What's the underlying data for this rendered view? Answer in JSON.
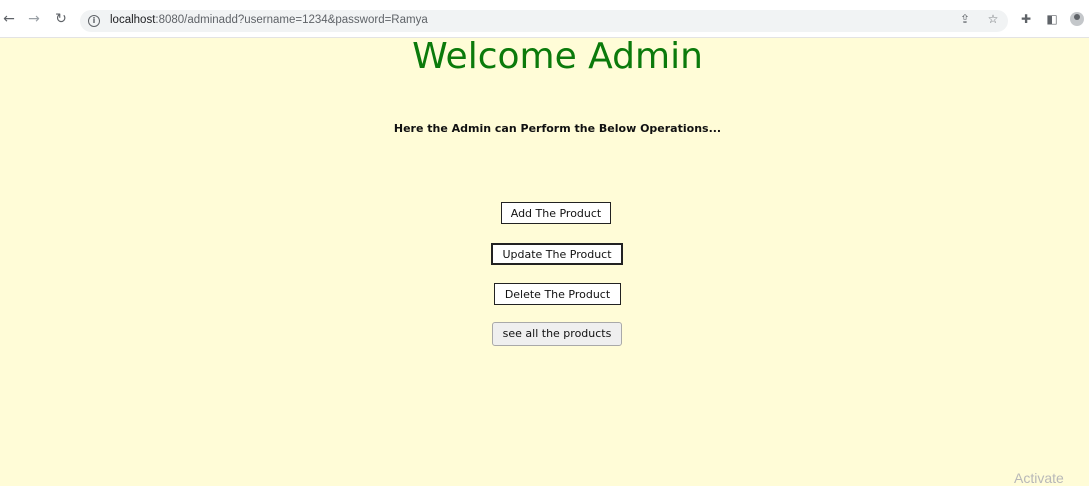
{
  "browser": {
    "url_host": "localhost",
    "url_rest": ":8080/adminadd?username=1234&password=Ramya"
  },
  "page": {
    "title": "Welcome Admin",
    "subtitle": "Here the Admin can Perform the Below Operations...",
    "buttons": {
      "add": "Add The Product",
      "update": "Update The Product",
      "delete": "Delete The Product",
      "see_all": "see all the products"
    }
  },
  "watermark": "Activate",
  "colors": {
    "background": "#fffcd7",
    "title": "#0b7a0b"
  },
  "icons": {
    "back": "back-arrow-icon",
    "forward": "forward-arrow-icon",
    "reload": "reload-icon",
    "info": "info-icon",
    "share": "share-icon",
    "bookmark": "star-icon",
    "extensions": "puzzle-icon",
    "sidebar": "side-panel-icon",
    "profile": "profile-icon"
  }
}
